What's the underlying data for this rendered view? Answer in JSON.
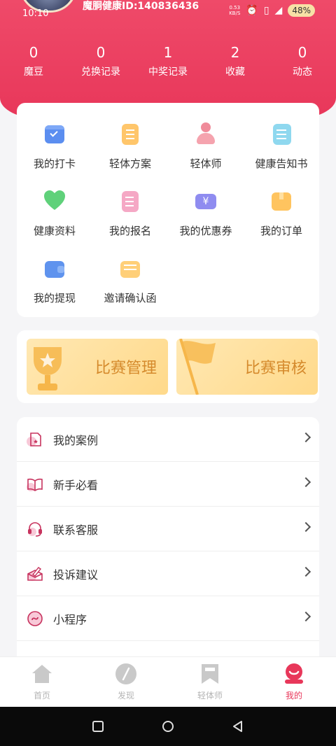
{
  "status": {
    "time": "10:10",
    "net_speed": "0.53\nKB/S",
    "signal": "4G",
    "battery": "48%"
  },
  "user": {
    "id_text": "魔胴健康ID:140836436"
  },
  "stats": [
    {
      "value": "0",
      "label": "魔豆"
    },
    {
      "value": "0",
      "label": "兑换记录"
    },
    {
      "value": "1",
      "label": "中奖记录"
    },
    {
      "value": "2",
      "label": "收藏"
    },
    {
      "value": "0",
      "label": "动态"
    }
  ],
  "grid": [
    {
      "label": "我的打卡",
      "icon": "calendar-check-icon"
    },
    {
      "label": "轻体方案",
      "icon": "plan-doc-icon"
    },
    {
      "label": "轻体师",
      "icon": "trainer-person-icon"
    },
    {
      "label": "健康告知书",
      "icon": "notice-doc-icon"
    },
    {
      "label": "健康资料",
      "icon": "heart-icon"
    },
    {
      "label": "我的报名",
      "icon": "signup-form-icon"
    },
    {
      "label": "我的优惠券",
      "icon": "coupon-icon"
    },
    {
      "label": "我的订单",
      "icon": "order-box-icon"
    },
    {
      "label": "我的提现",
      "icon": "wallet-icon"
    },
    {
      "label": "邀请确认函",
      "icon": "invitation-letter-icon"
    }
  ],
  "competition": {
    "manage": "比赛管理",
    "review": "比赛审核"
  },
  "menu": [
    {
      "label": "我的案例",
      "icon": "case-file-icon"
    },
    {
      "label": "新手必看",
      "icon": "book-icon"
    },
    {
      "label": "联系客服",
      "icon": "headset-icon"
    },
    {
      "label": "投诉建议",
      "icon": "envelope-pen-icon"
    },
    {
      "label": "小程序",
      "icon": "mini-program-icon"
    }
  ],
  "tabs": [
    {
      "label": "首页",
      "icon": "home-icon",
      "active": false
    },
    {
      "label": "发现",
      "icon": "compass-icon",
      "active": false
    },
    {
      "label": "轻体师",
      "icon": "bookmark-icon",
      "active": false
    },
    {
      "label": "我的",
      "icon": "profile-icon",
      "active": true
    }
  ],
  "colors": {
    "brand": "#e8375a",
    "accent_gold": "#d58a2c"
  }
}
